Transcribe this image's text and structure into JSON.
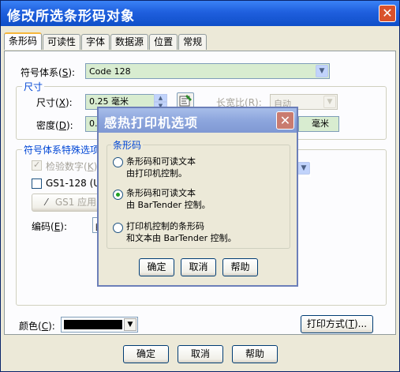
{
  "window": {
    "title": "修改所选条形码对象",
    "close_label": "✕"
  },
  "tabs": [
    "条形码",
    "可读性",
    "字体",
    "数据源",
    "位置",
    "常规"
  ],
  "symbology": {
    "label": "符号体系",
    "hotkey": "S",
    "value": "Code 128"
  },
  "size_group": {
    "title": "尺寸",
    "size_label": "尺寸",
    "size_hotkey": "X",
    "size_value": "0.25 毫米",
    "density_label": "密度",
    "density_hotkey": "D",
    "density_value": "0.",
    "aspect_label": "长宽比",
    "aspect_hotkey": "R",
    "aspect_value": "自动",
    "right_unit": "毫米"
  },
  "special_group": {
    "title": "符号体系特殊选项",
    "check_digit": "检验数字",
    "check_digit_hotkey": "K",
    "gs1_label": "GS1-128 (UCC",
    "gs1_app_button": "GS1 应用"
  },
  "encoding": {
    "label": "编码",
    "hotkey": "E",
    "value": "自"
  },
  "color": {
    "label": "颜色",
    "hotkey": "C",
    "value": "#000000"
  },
  "print_mode_button": "打印方式",
  "print_mode_hotkey": "T",
  "footer": {
    "ok": "确定",
    "cancel": "取消",
    "help": "帮助"
  },
  "popup": {
    "title": "感热打印机选项",
    "close_label": "✕",
    "group_title": "条形码",
    "options": [
      {
        "line1": "条形码和可读文本",
        "line2": "由打印机控制。",
        "selected": false
      },
      {
        "line1": "条形码和可读文本",
        "line2": "由 BarTender 控制。",
        "selected": true
      },
      {
        "line1": "打印机控制的条形码",
        "line2": "和文本由 BarTender 控制。",
        "selected": false
      }
    ],
    "ok": "确定",
    "cancel": "取消",
    "help": "帮助"
  }
}
